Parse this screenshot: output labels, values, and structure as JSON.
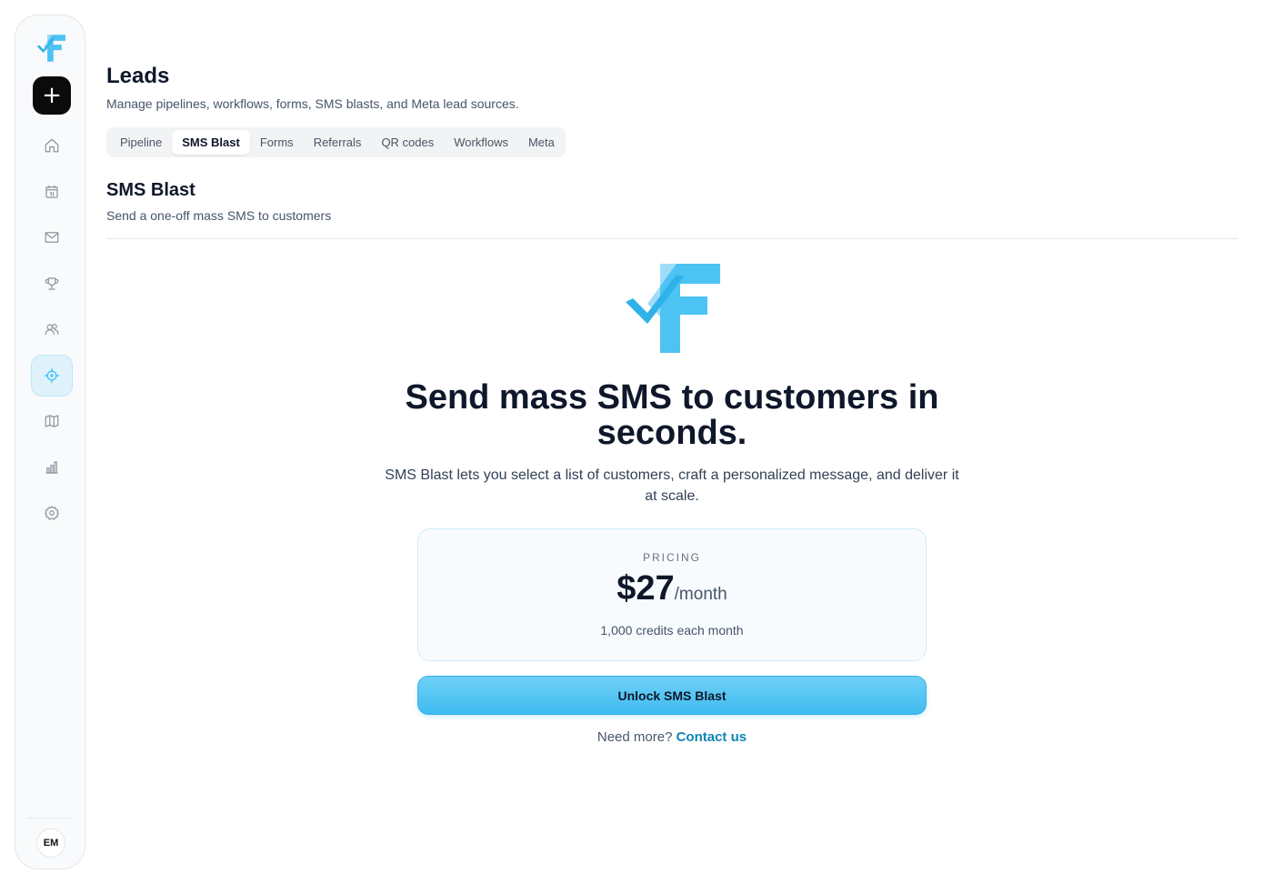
{
  "sidebar": {
    "new_label": "+",
    "items": [
      {
        "icon": "home-icon"
      },
      {
        "icon": "calendar-icon"
      },
      {
        "icon": "mail-icon"
      },
      {
        "icon": "trophy-icon"
      },
      {
        "icon": "users-icon"
      },
      {
        "icon": "crosshair-icon",
        "active": true
      },
      {
        "icon": "map-icon"
      },
      {
        "icon": "bar-chart-icon"
      },
      {
        "icon": "gear-icon"
      }
    ],
    "avatar": "EM",
    "accent_color": "#38bdf8"
  },
  "header": {
    "title": "Leads",
    "subtitle": "Manage pipelines, workflows, forms, SMS blasts, and Meta lead sources."
  },
  "tabs": [
    {
      "label": "Pipeline"
    },
    {
      "label": "SMS Blast",
      "active": true
    },
    {
      "label": "Forms"
    },
    {
      "label": "Referrals"
    },
    {
      "label": "QR codes"
    },
    {
      "label": "Workflows"
    },
    {
      "label": "Meta"
    }
  ],
  "section": {
    "title": "SMS Blast",
    "subtitle": "Send a one-off mass SMS to customers"
  },
  "hero": {
    "headline": "Send mass SMS to customers in seconds.",
    "description": "SMS Blast lets you select a list of customers, craft a personalized message, and deliver it at scale."
  },
  "pricing": {
    "label": "PRICING",
    "price": "$27",
    "period": "/month",
    "credits": "1,000 credits each month"
  },
  "cta": {
    "unlock_label": "Unlock SMS Blast",
    "need_more": "Need more?",
    "contact_label": "Contact us"
  }
}
